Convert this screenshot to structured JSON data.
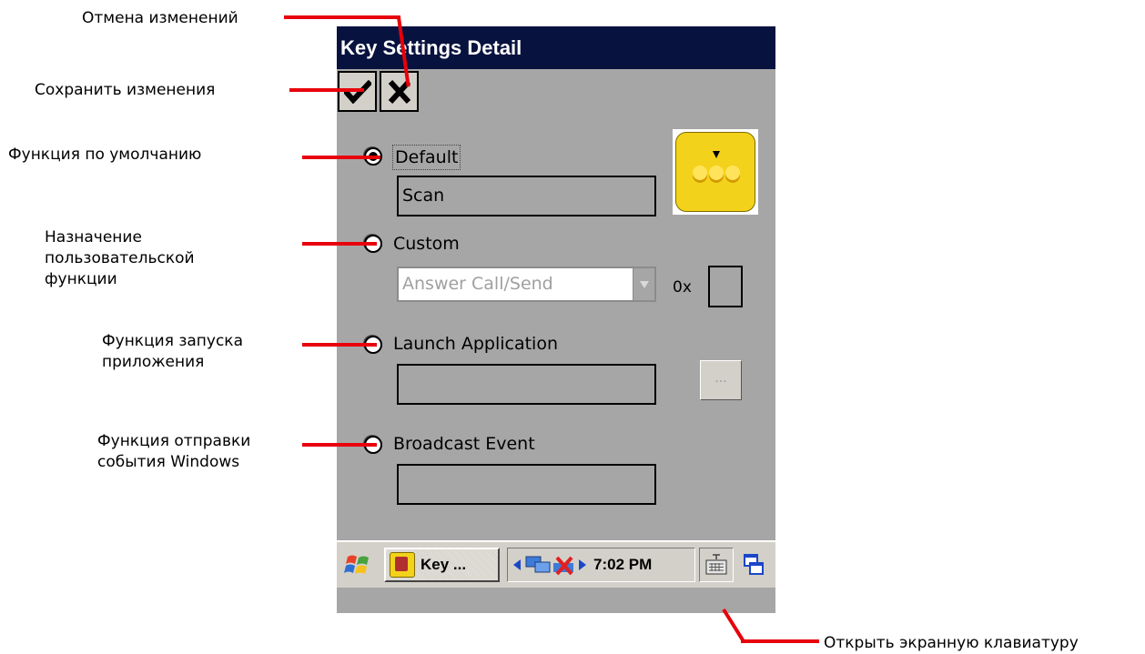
{
  "annotations": {
    "cancel": "Отмена изменений",
    "save": "Сохранить изменения",
    "default_function": "Функция по умолчанию",
    "custom_function": [
      "Назначение",
      "пользовательской",
      "функции"
    ],
    "launch_function": [
      "Функция запуска",
      "приложения"
    ],
    "broadcast_function": [
      "Функция отправки",
      "события Windows"
    ],
    "keyboard": "Открыть экранную клавиатуру"
  },
  "window": {
    "title": "Key Settings Detail"
  },
  "toolbar": {
    "save_icon": "checkmark-icon",
    "cancel_icon": "x-icon"
  },
  "options": {
    "default_label": "Default",
    "default_value": "Scan",
    "default_selected": true,
    "custom_label": "Custom",
    "custom_value": "Answer Call/Send",
    "hex_prefix": "0x",
    "launch_label": "Launch Application",
    "launch_browse": "...",
    "broadcast_label": "Broadcast Event"
  },
  "taskbar": {
    "start_icon": "windows-flag-icon",
    "task_label": "Key ...",
    "clock": "7:02 PM",
    "keyboard_icon": "keyboard-icon",
    "desktop_icon": "switch-windows-icon"
  },
  "colors": {
    "accent": "#e8000b",
    "titlebar": "#08123f",
    "screen_bg": "#a7a6a6",
    "key_icon": "#f3d21b"
  }
}
